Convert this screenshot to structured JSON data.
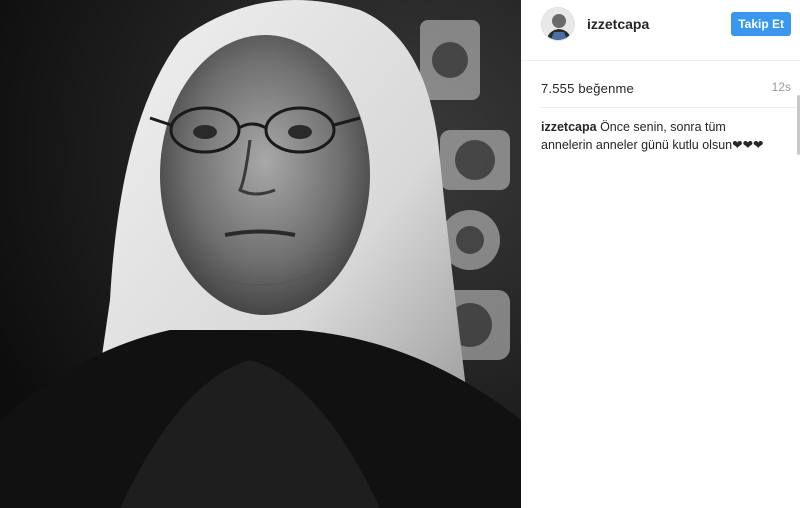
{
  "post": {
    "username": "izzetcapa",
    "follow_label": "Takip Et",
    "likes": "7.555 beğenme",
    "time_ago": "12s",
    "caption": {
      "username": "izzetcapa",
      "text": "Önce senin, sonra tüm annelerin anneler günü kutlu olsun❤❤❤"
    },
    "image_description_icon": "portrait-photo"
  },
  "colors": {
    "follow_button": "#3897f0",
    "text": "#262626",
    "muted": "#999999",
    "divider": "#efefef"
  }
}
